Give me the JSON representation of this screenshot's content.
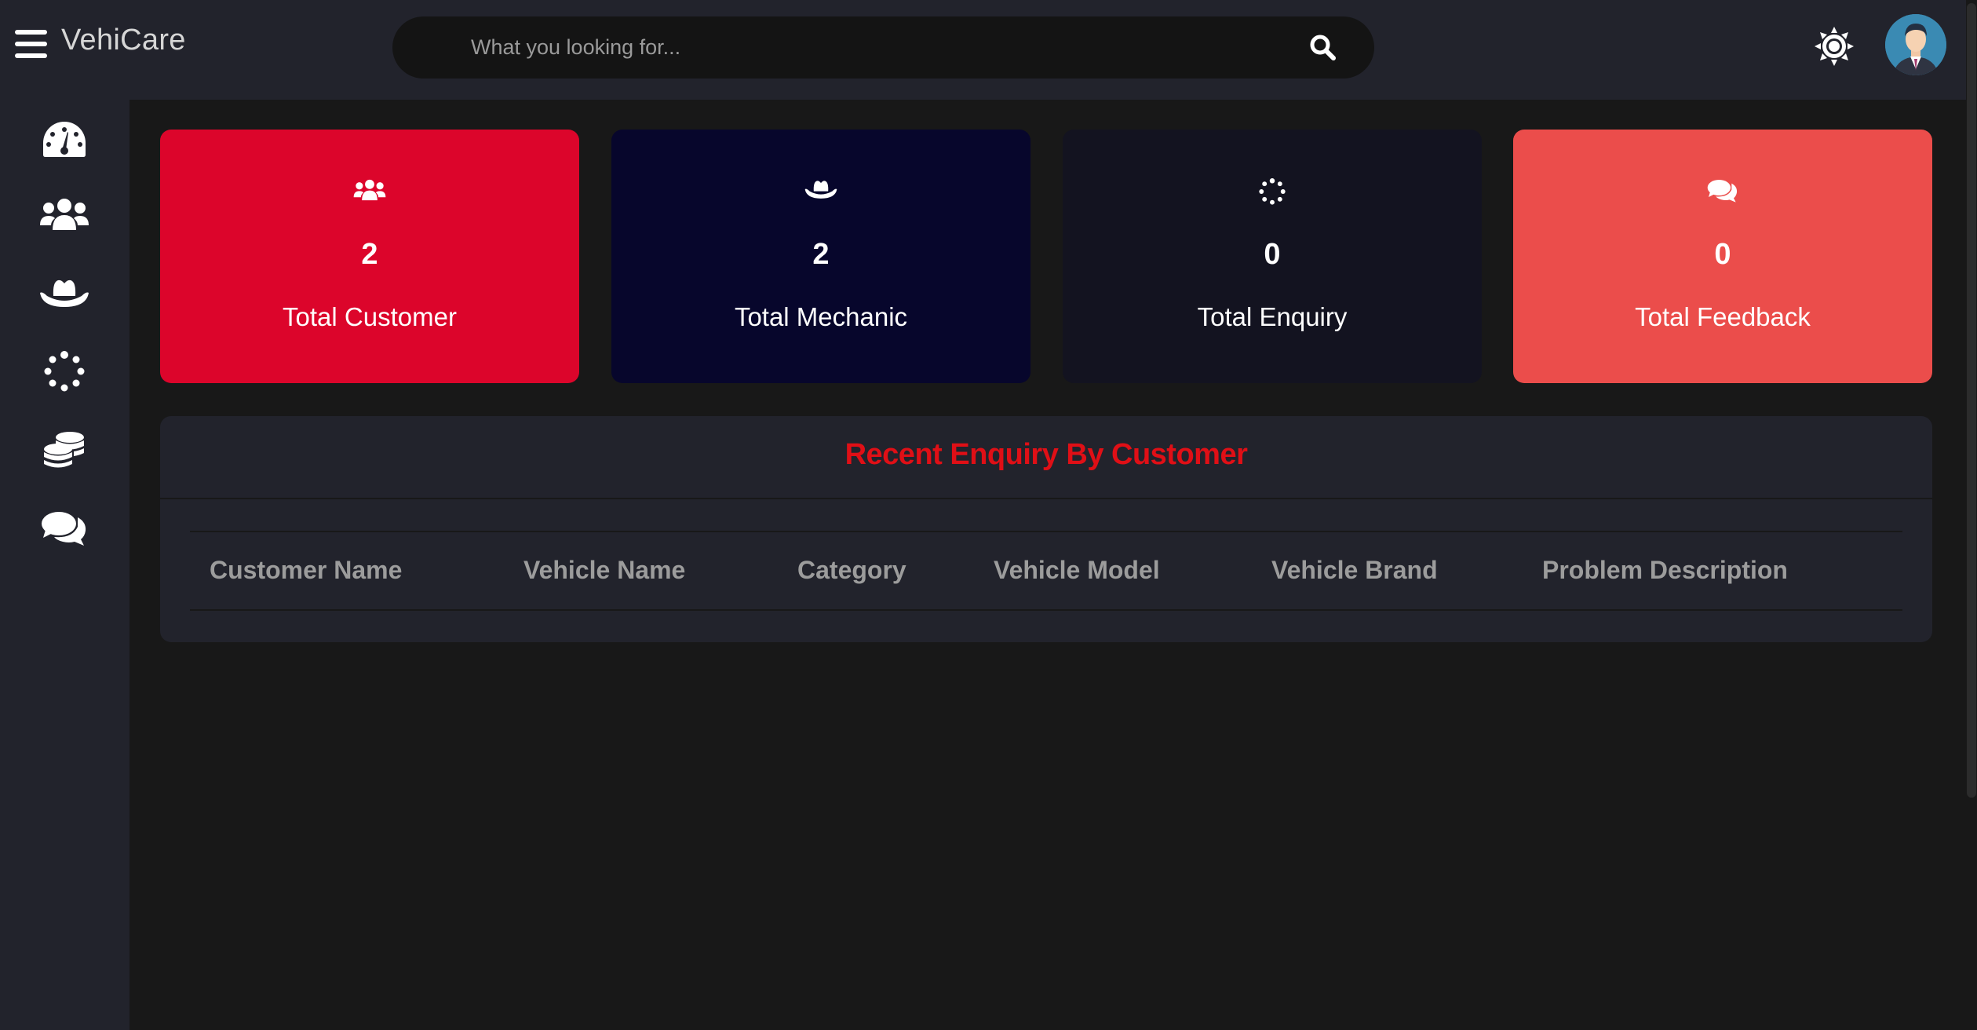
{
  "app": {
    "brand": "VehiCare"
  },
  "search": {
    "placeholder": "What you looking for..."
  },
  "header": {
    "icons": [
      "menu-icon",
      "search-icon",
      "sun-icon",
      "avatar"
    ]
  },
  "sidebar": {
    "items": [
      {
        "icon": "dashboard-icon"
      },
      {
        "icon": "users-icon"
      },
      {
        "icon": "hat-icon"
      },
      {
        "icon": "spinner-icon"
      },
      {
        "icon": "coins-icon"
      },
      {
        "icon": "comments-icon"
      }
    ]
  },
  "cards": [
    {
      "count": "2",
      "label": "Total Customer",
      "color": "#dc052b",
      "icon": "users-icon"
    },
    {
      "count": "2",
      "label": "Total Mechanic",
      "color": "#07062c",
      "icon": "hat-icon"
    },
    {
      "count": "0",
      "label": "Total Enquiry",
      "color": "#131320",
      "icon": "spinner-icon"
    },
    {
      "count": "0",
      "label": "Total Feedback",
      "color": "#eb4d4b",
      "icon": "comments-icon"
    }
  ],
  "enquiry": {
    "title": "Recent Enquiry By Customer",
    "title_color": "#e00f16",
    "columns": [
      "Customer Name",
      "Vehicle Name",
      "Category",
      "Vehicle Model",
      "Vehicle Brand",
      "Problem Description"
    ],
    "rows": []
  }
}
